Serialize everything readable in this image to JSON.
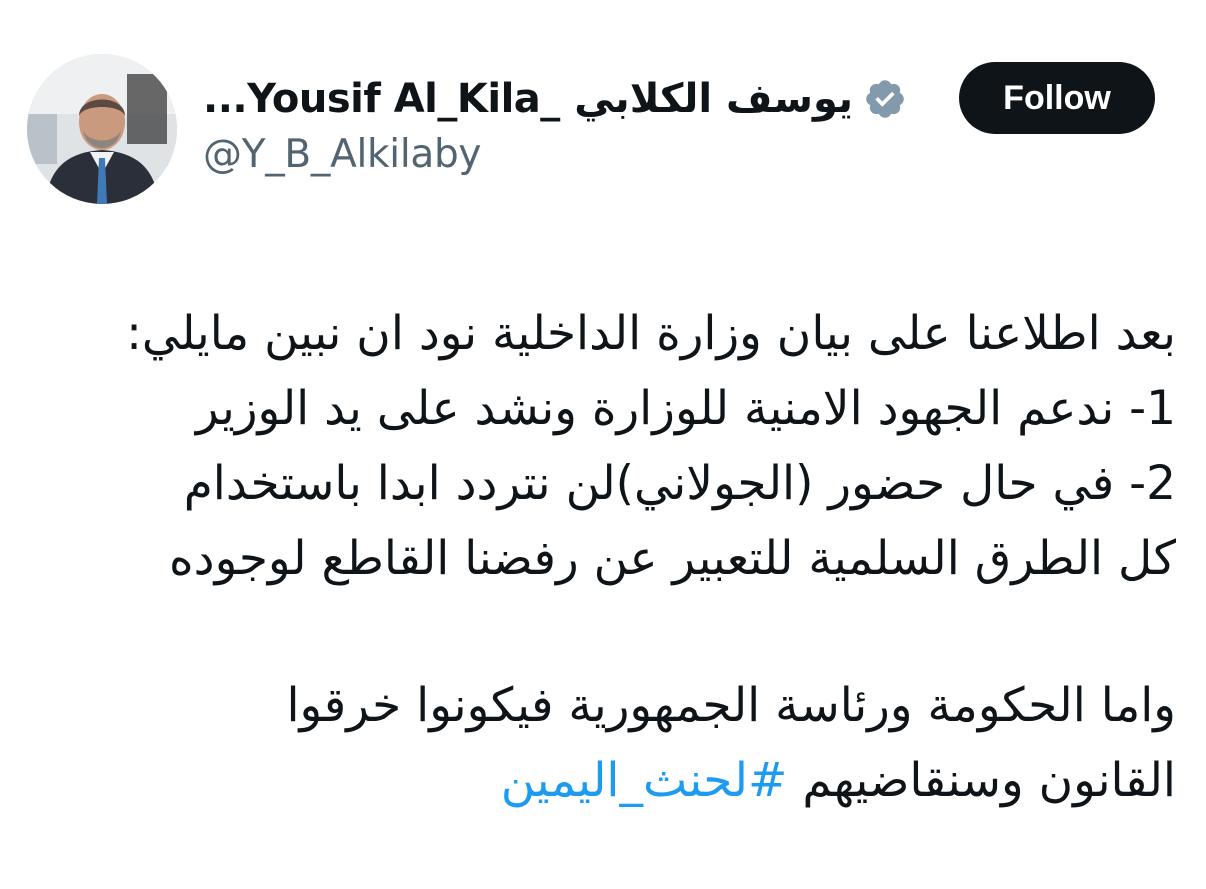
{
  "author": {
    "display_name": "يوسف الكلابي _Yousif Al_Kila...",
    "handle": "@Y_B_Alkilaby",
    "avatar_icon": "profile-photo",
    "verified_icon": "verified-badge-icon",
    "verified_color": "#829aab"
  },
  "follow_button": {
    "label": "Follow",
    "bg": "#0f1419",
    "fg": "#ffffff"
  },
  "tweet": {
    "lines": [
      "بعد اطلاعنا على بيان وزارة الداخلية نود ان نبين مايلي:",
      "1- ندعم الجهود الامنية للوزارة ونشد على يد الوزير",
      "2- في حال حضور (الجولاني)لن نتردد ابدا باستخدام",
      "كل الطرق السلمية للتعبير عن رفضنا القاطع لوجوده"
    ],
    "closing_line1": " واما الحكومة ورئاسة الجمهورية فيكونوا خرقوا",
    "closing_line2_text": "القانون وسنقاضيهم",
    "hashtag": "#لحنث_اليمين",
    "hashtag_color": "#1d9bf0"
  }
}
